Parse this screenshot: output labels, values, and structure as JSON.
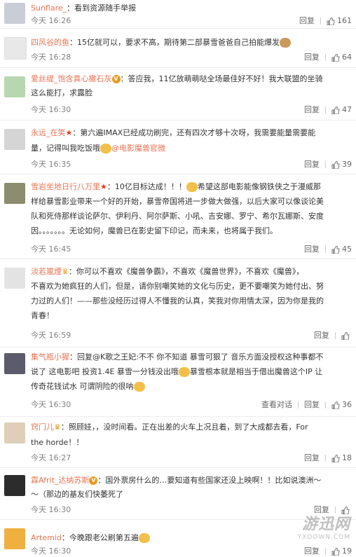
{
  "labels": {
    "reply": "回复",
    "view_conversation": "查看对话"
  },
  "comments": [
    {
      "name": "Sunflare_",
      "text": "：看到资源随手举报",
      "time": "今天 16:26",
      "likes": "161"
    },
    {
      "name": "四风谷的鱼",
      "text": "：15亿就可以，要求不高，期待第二部暴雪爸爸自己拍能爆发",
      "time": "今天 16:28",
      "likes": "64"
    },
    {
      "name": "爱丝缇_饱含真心撒石灰",
      "text": "：答应我，11亿放萌萌哒全场最佳好不好！我大联盟的坐骑",
      "text2": "这么能打，求露脸",
      "time": "今天 16:30",
      "likes": "47"
    },
    {
      "name": "永远_在笑",
      "text": "：第六遍IMAX已经成功刷完，还有四次才够十次呀，我需要能量需要能",
      "text2": "量，记得叫我吃饭哦",
      "mention": "@电影魔兽官微",
      "time": "今天 16:35",
      "likes": "39"
    },
    {
      "name": "雪岩坐地日行八万里",
      "text": "：10亿目标达成！！！",
      "text_b": "希望这部电影能像钢铁侠之于漫威那",
      "lines": [
        "样给暴雪影业带来一个好的开始，暴雪帝国将进一步做大做强，以后大家可以像谈论美",
        "队和死侍那样谈论萨尔、伊利丹、阿尔萨斯、小吼、吉安娜、罗宁、希尔瓦娜斯、安度",
        "因。。。。。。。无论如何，魔兽已在影史留下印记，而未来，也将属于我们。"
      ],
      "time": "今天 16:45",
      "likes": "45"
    },
    {
      "name": "淡若嵐煙",
      "text": "：你可以不喜欢《魔兽争霸》，不喜欢《魔兽世界》，不喜欢《魔兽》，",
      "lines": [
        "不喜欢为她疯狂的人们，但是，请你别嘲笑她的文化与历史，更不要嘲笑为她付出、努",
        "力过的人们！——那些没经历过得人不懂我的认真，笑我对你用情太深，因为你是我的",
        "青春！"
      ],
      "time": "今天 16:59",
      "likes": ""
    },
    {
      "name": "集气瓶小猩",
      "text": "：回复@K歌之王妃:不不 你不知道 暴雪可狠了 音乐方面没授权这种事都不",
      "lines": [
        "说了 这电影吧 投资1.4E 暴雪一分钱没出哦",
        "暴雪根本就是相当于借出魔兽这个IP 让",
        "传奇花钱试水 可谓阴险的很呐"
      ],
      "time": "今天 16:30",
      "likes": "36"
    },
    {
      "name": "窍门儿",
      "text": "：照顾娃，，没时间看。正在出差的火车上况且着，到了大成都去看，For",
      "text2": "the horde！！",
      "time": "今天 16:27",
      "likes": "18"
    },
    {
      "name": "霖Afrit_达纳苏斯",
      "text": "：国外票房什么的…要知道有些国家还没上映啊！！比如说澳洲～",
      "text2": "～（那边的基友们快萎死了",
      "time": "今天 16:30",
      "likes": ""
    },
    {
      "name": "Artemid",
      "text": "：今晚跟老公刷第五遍",
      "time": "今天 16:30",
      "likes": "19"
    }
  ],
  "watermark": {
    "line1": "游迅网",
    "line2": "YXDOWN.COM"
  }
}
